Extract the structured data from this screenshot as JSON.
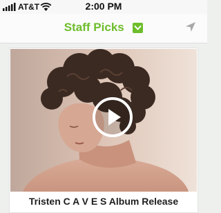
{
  "status_bar": {
    "carrier": "AT&T",
    "time": "2:00 PM",
    "signal_icon": "signal-bars-icon",
    "wifi_icon": "wifi-icon"
  },
  "nav": {
    "title": "Staff Picks",
    "dropdown_icon": "chevron-down-icon",
    "location_icon": "location-arrow-icon",
    "accent_color": "#6dbd2b"
  },
  "featured": {
    "title": "Tristen C A V E S Album Release",
    "play_icon": "play-icon"
  }
}
